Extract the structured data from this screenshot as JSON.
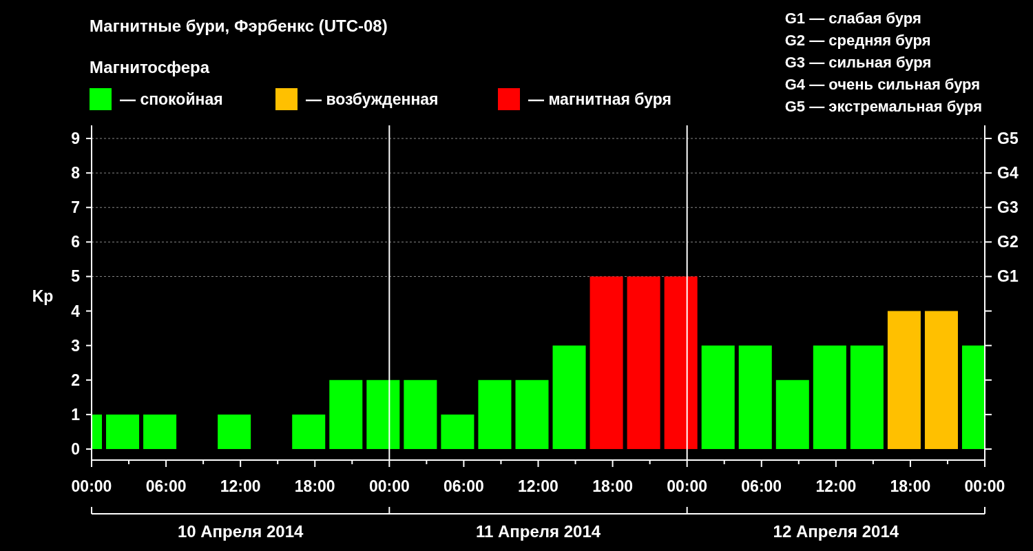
{
  "title": "Магнитные бури, Фэрбенкс (UTC-08)",
  "subtitle": "Магнитосфера",
  "scale": [
    "G1 — слабая буря",
    "G2 — средняя буря",
    "G3 — сильная буря",
    "G4 — очень сильная буря",
    "G5 — экстремальная буря"
  ],
  "right_axis": {
    "labels": [
      "G5",
      "G4",
      "G3",
      "G2",
      "G1"
    ]
  },
  "days": [
    {
      "label": "10 Апреля 2014"
    },
    {
      "label": "11 Апреля 2014"
    },
    {
      "label": "12 Апреля 2014"
    }
  ],
  "chart_data": {
    "type": "bar",
    "ylabel": "Kp",
    "xlim": [
      "2014-04-10T00:00",
      "2014-04-13T00:00"
    ],
    "ylim": [
      -0.32,
      9.38
    ],
    "grid": true,
    "x": [
      "2014-04-10T00:25",
      "2014-04-10T02:30",
      "2014-04-10T05:30",
      "2014-04-10T08:30",
      "2014-04-10T11:30",
      "2014-04-10T14:30",
      "2014-04-10T17:30",
      "2014-04-10T20:30",
      "2014-04-10T23:30",
      "2014-04-11T02:30",
      "2014-04-11T05:30",
      "2014-04-11T08:30",
      "2014-04-11T11:30",
      "2014-04-11T14:30",
      "2014-04-11T17:30",
      "2014-04-11T20:30",
      "2014-04-11T23:30",
      "2014-04-12T02:30",
      "2014-04-12T05:30",
      "2014-04-12T08:30",
      "2014-04-12T11:30",
      "2014-04-12T14:30",
      "2014-04-12T17:30",
      "2014-04-12T20:30",
      "2014-04-12T23:30"
    ],
    "yticks": [
      0,
      1,
      2,
      3,
      4,
      5,
      6,
      7,
      8,
      9
    ],
    "xticks": [
      {
        "value": "2014-04-10T00:00",
        "label": "00:00"
      },
      {
        "value": "2014-04-10T06:00",
        "label": "06:00"
      },
      {
        "value": "2014-04-10T12:00",
        "label": "12:00"
      },
      {
        "value": "2014-04-10T18:00",
        "label": "18:00"
      },
      {
        "value": "2014-04-11T00:00",
        "label": "00:00"
      },
      {
        "value": "2014-04-11T06:00",
        "label": "06:00"
      },
      {
        "value": "2014-04-11T12:00",
        "label": "12:00"
      },
      {
        "value": "2014-04-11T18:00",
        "label": "18:00"
      },
      {
        "value": "2014-04-12T00:00",
        "label": "00:00"
      },
      {
        "value": "2014-04-12T06:00",
        "label": "06:00"
      },
      {
        "value": "2014-04-12T12:00",
        "label": "12:00"
      },
      {
        "value": "2014-04-12T18:00",
        "label": "18:00"
      },
      {
        "value": "2014-04-13T00:00",
        "label": "00:00"
      }
    ],
    "series": [
      {
        "name": "— спокойная",
        "color": "#00ff00",
        "values": [
          1,
          1,
          1,
          null,
          1,
          null,
          1,
          2,
          2,
          2,
          1,
          2,
          2,
          3,
          null,
          null,
          null,
          3,
          3,
          2,
          3,
          3,
          null,
          null,
          3
        ]
      },
      {
        "name": "— возбужденная",
        "color": "#ffc000",
        "values": [
          null,
          null,
          null,
          null,
          null,
          null,
          null,
          null,
          null,
          null,
          null,
          null,
          null,
          null,
          null,
          null,
          null,
          null,
          null,
          null,
          null,
          null,
          4,
          4,
          null
        ]
      },
      {
        "name": "— магнитная буря",
        "color": "#ff0000",
        "values": [
          null,
          null,
          null,
          null,
          null,
          null,
          null,
          null,
          null,
          null,
          null,
          null,
          null,
          null,
          5,
          5,
          5,
          null,
          null,
          null,
          null,
          null,
          null,
          null,
          null
        ]
      }
    ]
  }
}
